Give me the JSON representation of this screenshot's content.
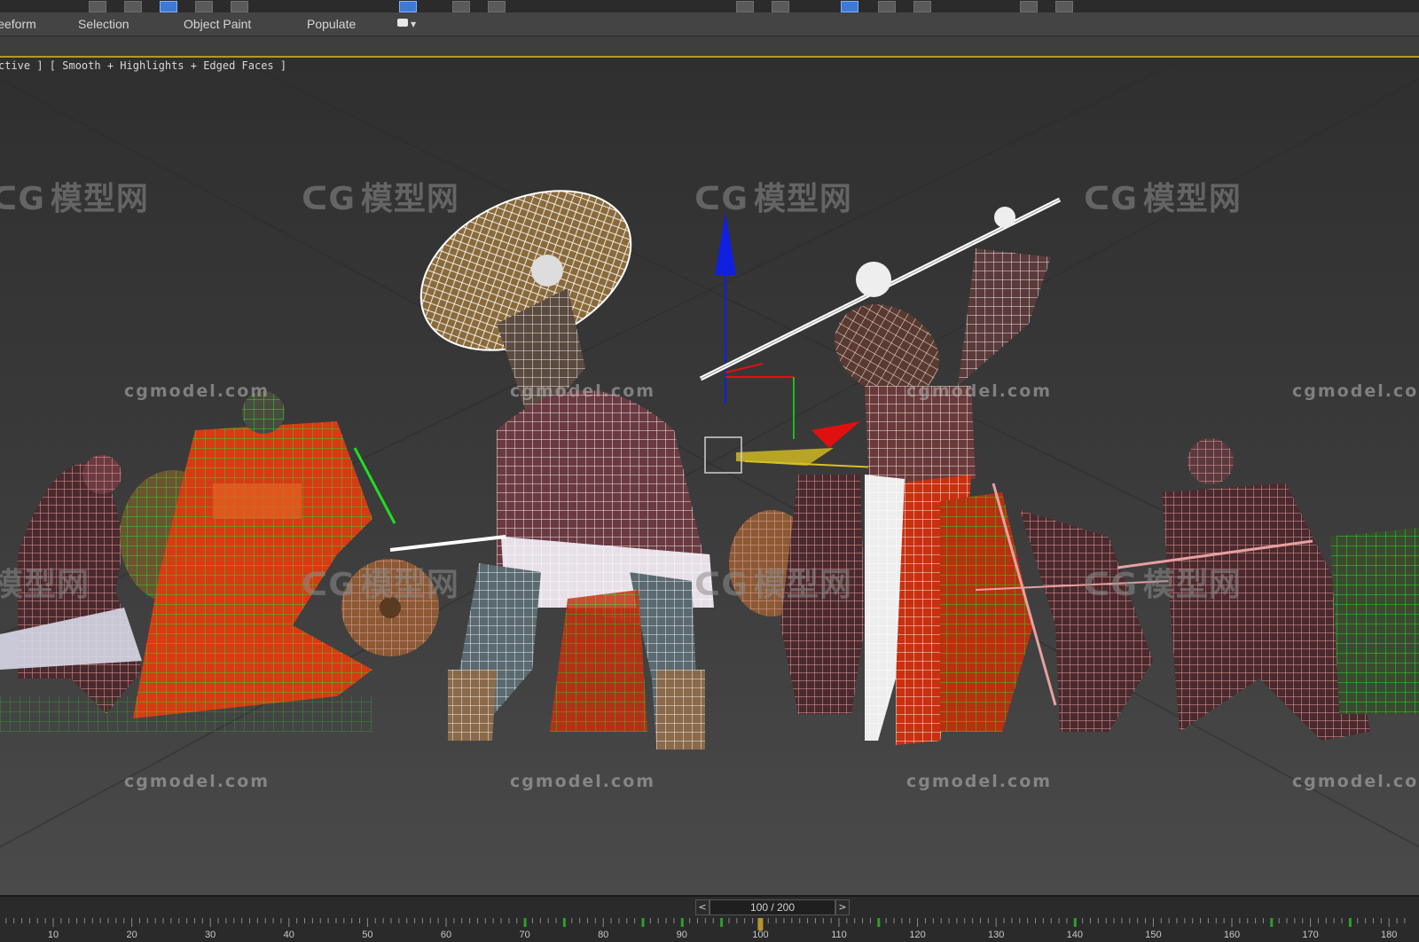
{
  "ribbon": {
    "tabs": [
      {
        "label": "Freeform"
      },
      {
        "label": "Selection"
      },
      {
        "label": "Object Paint"
      },
      {
        "label": "Populate"
      }
    ]
  },
  "viewport": {
    "label": "[ + ] [ Perspective ] [ Smooth + Highlights + Edged Faces ]",
    "visible_label": "ctive ] [ Smooth + Highlights + Edged Faces ]"
  },
  "watermark": {
    "logo_text": "模型网",
    "url_text": "cgmodel.com"
  },
  "timeline": {
    "frame_display": "100 / 200",
    "prev_label": "<",
    "next_label": ">",
    "current_frame": 100,
    "total_frames": 200,
    "tick_labels": [
      "10",
      "20",
      "30",
      "40",
      "50",
      "60",
      "70",
      "80",
      "90",
      "100",
      "110",
      "120",
      "130",
      "140",
      "150",
      "160",
      "170",
      "180"
    ]
  },
  "colors": {
    "accent_gold": "#b4962c",
    "gizmo_z": "#1020e0",
    "gizmo_x": "#e01010",
    "gizmo_y": "#10c020",
    "selected_wire": "#ffffff",
    "wire_green": "#22dd22",
    "wire_pink": "#e8a0a0"
  }
}
